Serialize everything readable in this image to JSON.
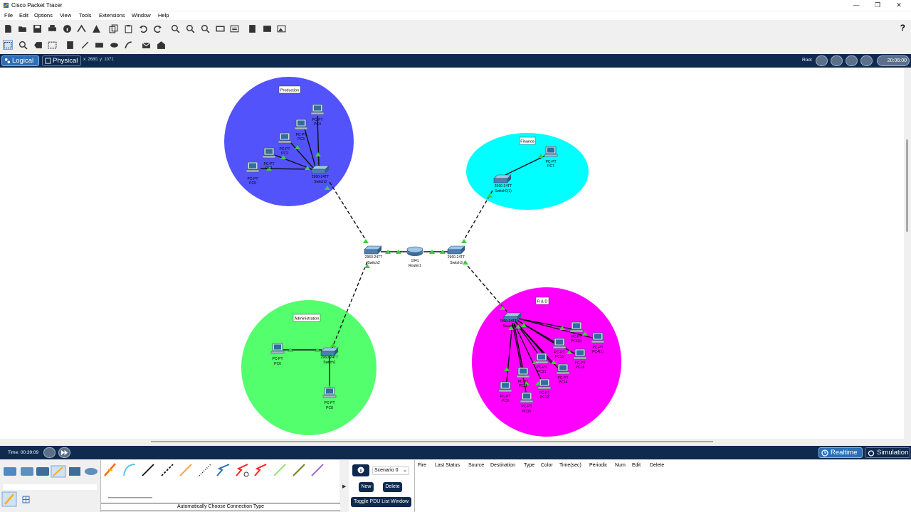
{
  "window": {
    "title": "Cisco Packet Tracer",
    "minimize_icon": "minimize-icon",
    "maximize_icon": "restore-icon",
    "close_icon": "close-icon"
  },
  "menu": [
    "File",
    "Edit",
    "Options",
    "View",
    "Tools",
    "Extensions",
    "Window",
    "Help"
  ],
  "help_label": "?",
  "modebar": {
    "logical_label": "Logical",
    "physical_label": "Physical",
    "coords": "x: 2680, y: 1071",
    "root_label": "Root",
    "clock": "20:06:00"
  },
  "zones": [
    {
      "label": "Production",
      "color": "#5353fb"
    },
    {
      "label": "Finance",
      "color": "#00ffff"
    },
    {
      "label": "Administration",
      "color": "#54ff6e"
    },
    {
      "label": "R & D",
      "color": "#ff00ff"
    }
  ],
  "devices": {
    "switch2": {
      "model": "2960-24TT",
      "name": "Switch2"
    },
    "router1": {
      "model": "1941",
      "name": "Router1"
    },
    "switch3": {
      "model": "2960-24TT",
      "name": "Switch3"
    },
    "switch0": {
      "model": "2960-24TT",
      "name": "Switch0"
    },
    "switch0_1": {
      "model": "2960-24TT",
      "name": "Switch0(1)"
    },
    "switch1": {
      "model": "2960-24TT",
      "name": "Switch1"
    },
    "switch_rd": {
      "model": "2960-24TT",
      "name": "Switch"
    },
    "pc0": {
      "model": "PC-PT",
      "name": "PC0"
    },
    "pc1": {
      "model": "PC-PT",
      "name": "PC1"
    },
    "pc2": {
      "model": "PC-PT",
      "name": "PC2"
    },
    "pc3": {
      "model": "PC-PT",
      "name": "PC3"
    },
    "pc4": {
      "model": "PC-PT",
      "name": "PC4"
    },
    "pc5": {
      "model": "PC-PT",
      "name": "PC5"
    },
    "pc7": {
      "model": "PC-PT",
      "name": "PC7"
    },
    "pc6": {
      "model": "PC-PT",
      "name": "PC6"
    },
    "pc8": {
      "model": "PC-PT",
      "name": "PC8"
    },
    "rd_pcs": [
      {
        "model": "PC-PT",
        "name": "PC9"
      },
      {
        "model": "PC-PT",
        "name": "PC10"
      },
      {
        "model": "PC-PT",
        "name": "PC11"
      },
      {
        "model": "PC-PT",
        "name": "PC12"
      },
      {
        "model": "PC-PT",
        "name": "PC13"
      },
      {
        "model": "PC-PT",
        "name": "PC14"
      },
      {
        "model": "PC-PT",
        "name": "PC15"
      },
      {
        "model": "PC-PT",
        "name": "PC16"
      },
      {
        "model": "PC-PT",
        "name": "PC4(1)"
      },
      {
        "model": "PC-PT",
        "name": "PC5(1)"
      },
      {
        "model": "PC-PT",
        "name": "PC6(1)"
      },
      {
        "model": "PC-PT",
        "name": "PC7(1)"
      }
    ]
  },
  "status": {
    "time": "Time: 00:39:09",
    "realtime_label": "Realtime",
    "simulation_label": "Simulation"
  },
  "connections_label": "Automatically Choose Connection Type",
  "scenario": {
    "value": "Scenario 0",
    "new_label": "New",
    "delete_label": "Delete",
    "toggle_label": "Toggle PDU List Window"
  },
  "pdu_columns": [
    "Fire",
    "Last Status",
    "Source",
    "Destination",
    "Type",
    "Color",
    "Time(sec)",
    "Periodic",
    "Num",
    "Edit",
    "Delete"
  ]
}
